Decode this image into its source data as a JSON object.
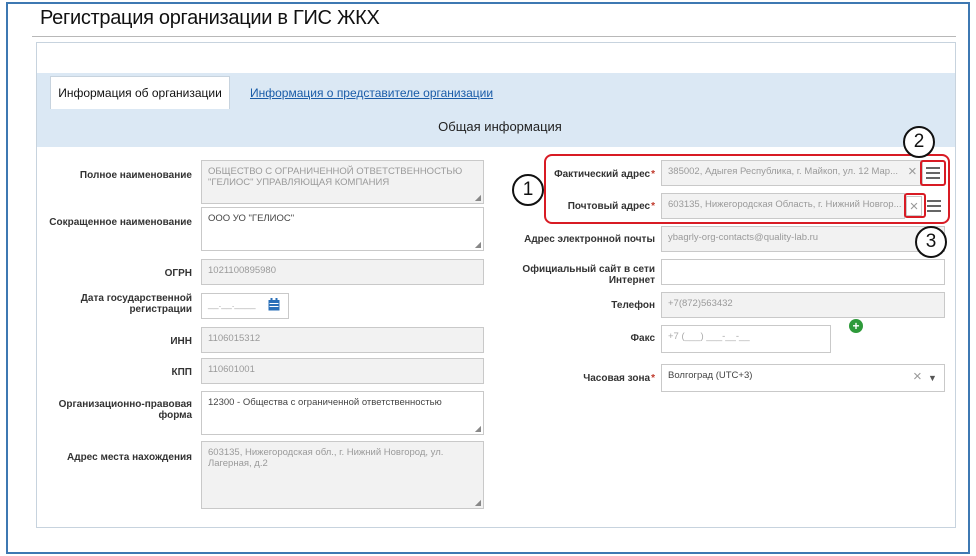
{
  "page": {
    "title": "Регистрация организации в ГИС ЖКХ",
    "tabs": [
      {
        "label": "Информация об организации",
        "active": true
      },
      {
        "label": "Информация о представителе организации",
        "active": false
      }
    ],
    "section_title": "Общая информация"
  },
  "left_form": {
    "full_name": {
      "label": "Полное наименование",
      "value": "ОБЩЕСТВО С ОГРАНИЧЕННОЙ ОТВЕТСТВЕННОСТЬЮ \"ГЕЛИОС\" УПРАВЛЯЮЩАЯ КОМПАНИЯ"
    },
    "short_name": {
      "label": "Сокращенное наименование",
      "value": "ООО УО \"ГЕЛИОС\""
    },
    "ogrn": {
      "label": "ОГРН",
      "value": "1021100895980"
    },
    "reg_date": {
      "label": "Дата государственной регистрации",
      "placeholder": "__.__.____"
    },
    "inn": {
      "label": "ИНН",
      "value": "1106015312"
    },
    "kpp": {
      "label": "КПП",
      "value": "110601001"
    },
    "legal_form": {
      "label": "Организационно-правовая форма",
      "value": "12300 - Общества с ограниченной ответственностью"
    },
    "location_address": {
      "label": "Адрес места нахождения",
      "value": "603135, Нижегородская обл., г. Нижний Новгород, ул. Лагерная, д.2"
    }
  },
  "right_form": {
    "actual_address": {
      "label": "Фактический адрес",
      "value": "385002, Адыгея Республика, г. Майкоп, ул. 12 Мар..."
    },
    "postal_address": {
      "label": "Почтовый адрес",
      "value": "603135, Нижегородская Область, г. Нижний Новгор..."
    },
    "email": {
      "label": "Адрес электронной почты",
      "value": "ybagrly-org-contacts@quality-lab.ru"
    },
    "website": {
      "label": "Официальный сайт в сети Интернет",
      "value": ""
    },
    "phone": {
      "label": "Телефон",
      "value": "+7(872)563432"
    },
    "fax": {
      "label": "Факс",
      "value": "+7 (___) ___-__-__"
    },
    "timezone": {
      "label": "Часовая зона",
      "value": "Волгоград (UTC+3)"
    }
  },
  "callouts": {
    "c1": "1",
    "c2": "2",
    "c3": "3"
  },
  "glyphs": {
    "clear": "×",
    "dropdown": "▼",
    "add": "+",
    "resize": "◢"
  },
  "colors": {
    "frame": "#3e78b2",
    "tabbar": "#dbe8f4",
    "callout": "#d81b24",
    "link": "#1a5ca8",
    "required": "#c0392b",
    "add_green": "#2e9a3a",
    "calendar_blue": "#2a6fb8"
  }
}
